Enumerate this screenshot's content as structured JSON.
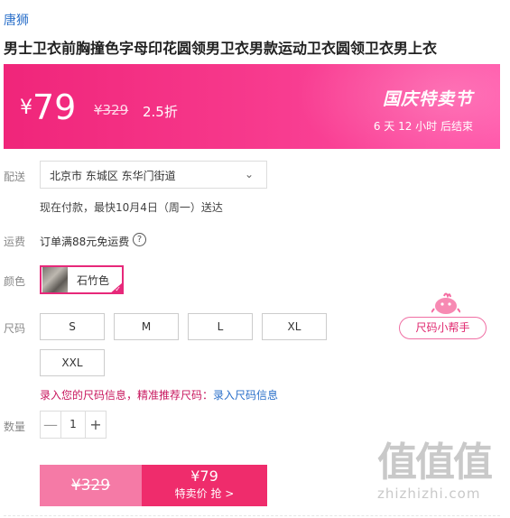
{
  "brand": "唐狮",
  "product_title": "男士卫衣前胸撞色字母印花圆领男卫衣男款运动卫衣圆领卫衣男上衣",
  "banner": {
    "currency": "¥",
    "price": "79",
    "original_price": "¥329",
    "discount": "2.5折",
    "festival": "国庆特卖节",
    "countdown": "6 天 12 小时 后结束"
  },
  "labels": {
    "delivery": "配送",
    "shipping": "运费",
    "color": "颜色",
    "size": "尺码",
    "quantity": "数量"
  },
  "delivery": {
    "address": "北京市 东城区 东华门街道",
    "estimate": "现在付款，最快10月4日（周一）送达"
  },
  "shipping": {
    "text": "订单满88元免运费",
    "help_icon": "?"
  },
  "color_option": {
    "name": "石竹色",
    "selected": true
  },
  "sizes": [
    "S",
    "M",
    "L",
    "XL",
    "XXL"
  ],
  "size_helper": "尺码小帮手",
  "size_info": {
    "prompt": "录入您的尺码信息，精准推荐尺码：",
    "link": "录入尺码信息"
  },
  "quantity": {
    "minus": "—",
    "value": "1",
    "plus": "+"
  },
  "buy": {
    "original_price": "¥329",
    "price": "¥79",
    "label": "特卖价 抢 >"
  },
  "watermark": {
    "logo": "值值值",
    "url": "zhizhizhi.com"
  },
  "colors": {
    "accent": "#ef2c6c",
    "link": "#2a6fc9",
    "banner_start": "#f0257a",
    "banner_end": "#ff4fa6"
  }
}
